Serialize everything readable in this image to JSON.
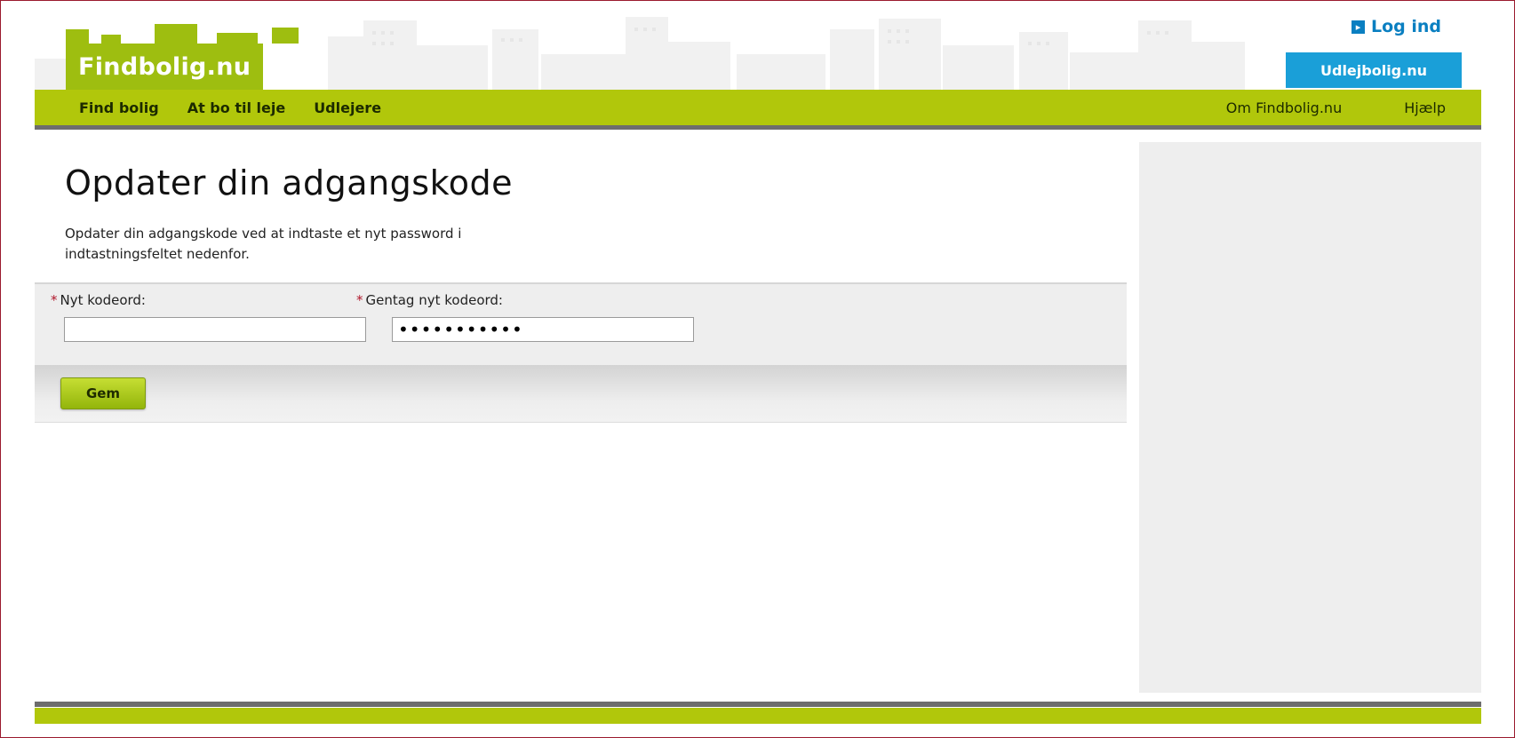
{
  "header": {
    "logo_text": "Findbolig.nu",
    "login_label": "Log ind",
    "login_icon": "arrow-right-square-icon",
    "partner_button_label": "Udlejbolig.nu"
  },
  "nav": {
    "left_items": [
      "Find bolig",
      "At bo til leje",
      "Udlejere"
    ],
    "right_items": [
      "Om Findbolig.nu",
      "Hjælp"
    ]
  },
  "main": {
    "title": "Opdater din adgangskode",
    "intro_line1": "Opdater din adgangskode ved at indtaste et nyt password i",
    "intro_line2": "indtastningsfeltet nedenfor.",
    "required_marker": "*",
    "fields": [
      {
        "label": "Nyt kodeord:",
        "value": ""
      },
      {
        "label": "Gentag nyt kodeord:",
        "value": "•••••••••••"
      }
    ],
    "save_button_label": "Gem"
  },
  "colors": {
    "brand_green": "#b1c70b",
    "logo_green": "#9ebe10",
    "partner_blue": "#1a9fd8",
    "link_blue": "#0a7fc1",
    "required_red": "#b0172b"
  }
}
